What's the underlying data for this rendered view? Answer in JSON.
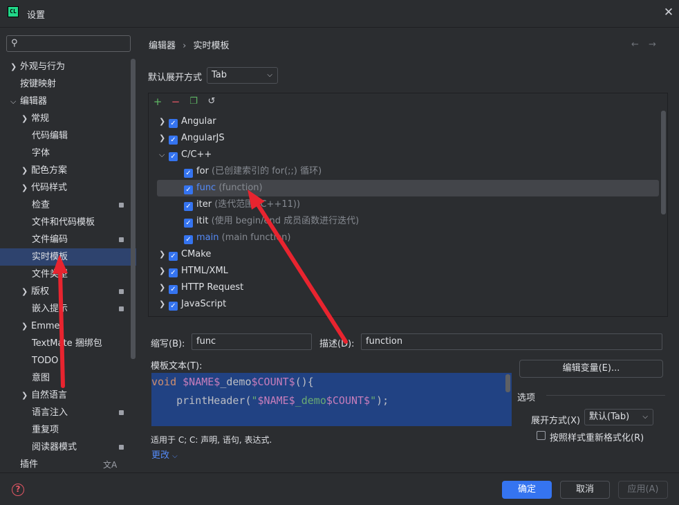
{
  "window": {
    "icon_text": "CL",
    "title": "设置",
    "close": "✕"
  },
  "search": {
    "placeholder": ""
  },
  "sidebar": {
    "items": [
      {
        "label": "外观与行为"
      },
      {
        "label": "按键映射"
      },
      {
        "label": "编辑器"
      },
      {
        "label": "常规"
      },
      {
        "label": "代码编辑"
      },
      {
        "label": "字体"
      },
      {
        "label": "配色方案"
      },
      {
        "label": "代码样式"
      },
      {
        "label": "检查"
      },
      {
        "label": "文件和代码模板"
      },
      {
        "label": "文件编码"
      },
      {
        "label": "实时模板"
      },
      {
        "label": "文件类型"
      },
      {
        "label": "版权"
      },
      {
        "label": "嵌入提示"
      },
      {
        "label": "Emmet"
      },
      {
        "label": "TextMate 捆绑包"
      },
      {
        "label": "TODO"
      },
      {
        "label": "意图"
      },
      {
        "label": "自然语言"
      },
      {
        "label": "语言注入"
      },
      {
        "label": "重复项"
      },
      {
        "label": "阅读器模式"
      },
      {
        "label": "插件"
      }
    ]
  },
  "breadcrumb": {
    "parent": "编辑器",
    "sep": "›",
    "current": "实时模板"
  },
  "expand": {
    "label": "默认展开方式",
    "value": "Tab"
  },
  "templates": {
    "groups": [
      {
        "name": "Angular"
      },
      {
        "name": "AngularJS"
      },
      {
        "name": "C/C++"
      },
      {
        "name": "CMake"
      },
      {
        "name": "HTML/XML"
      },
      {
        "name": "HTTP Request"
      },
      {
        "name": "JavaScript"
      }
    ],
    "cpp_items": [
      {
        "abbr": "for",
        "desc": "(已创建索引的 for(;;) 循环)"
      },
      {
        "abbr": "func",
        "desc": "(function)"
      },
      {
        "abbr": "iter",
        "desc": "(迭代范围 (C++11))"
      },
      {
        "abbr": "itit",
        "desc": "(使用 begin/end 成员函数进行迭代)"
      },
      {
        "abbr": "main",
        "desc": "(main function)"
      }
    ]
  },
  "form": {
    "abbr_label": "缩写(B):",
    "abbr_value": "func",
    "desc_label": "描述(D):",
    "desc_value": "function",
    "template_text_label": "模板文本(T):",
    "edit_vars": "编辑变量(E)...",
    "options_label": "选项",
    "expand_with_label": "展开方式(X)",
    "expand_with_value": "默认(Tab)",
    "reformat_label": "按照样式重新格式化(R)",
    "applies_to": "适用于 C; C: 声明, 语句, 表达式.",
    "change": "更改"
  },
  "code": {
    "line1": [
      "void",
      " ",
      "$NAME$",
      "_demo",
      "$COUNT$",
      "(){"
    ],
    "line2": [
      "    printHeader(",
      "\"",
      "$NAME$",
      "_demo",
      "$COUNT$",
      "\"",
      ");"
    ]
  },
  "buttons": {
    "ok": "确定",
    "cancel": "取消",
    "apply": "应用(A)"
  },
  "colors": {
    "accent": "#3574f0",
    "selection": "#2e436e",
    "annotation_arrow": "#e8242f"
  }
}
